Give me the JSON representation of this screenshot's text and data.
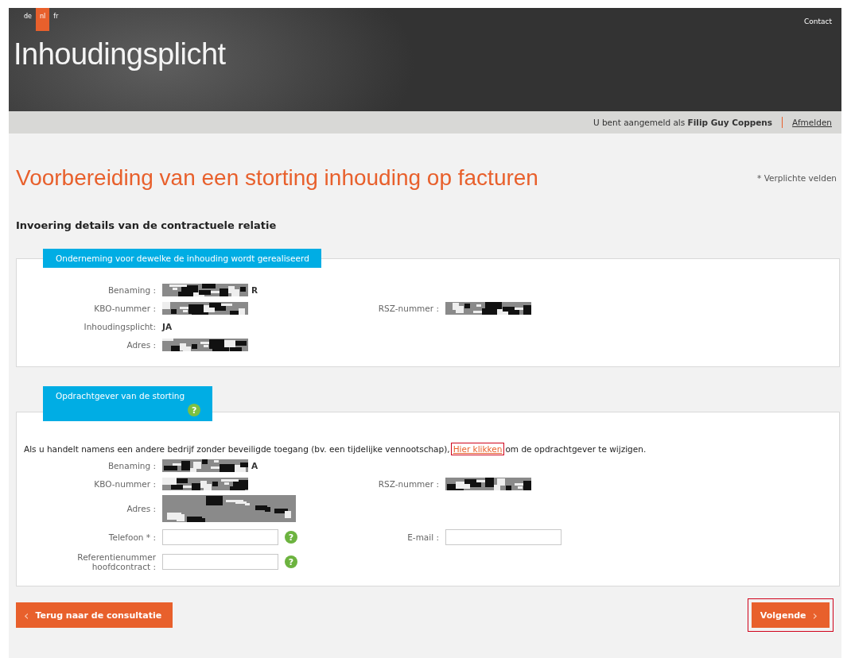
{
  "header": {
    "languages": [
      {
        "label": "de",
        "selected": false
      },
      {
        "label": "nl",
        "selected": true
      },
      {
        "label": "fr",
        "selected": false
      }
    ],
    "contact": "Contact",
    "logo": "Inhoudingsplicht"
  },
  "user_bar": {
    "text": "U bent aangemeld als **Filip Guy Coppens**",
    "logout": "Afmelden"
  },
  "page": {
    "title": "Voorbereiding van een storting inhouding op facturen",
    "required_note": "* Verplichte velden",
    "subtitle": "Invoering details van de contractuele relatie"
  },
  "sections": [
    {
      "title": "Onderneming voor dewelke de inhouding wordt gerealiseerd",
      "rows": [
        {
          "fields": [
            {
              "label": "Benaming :",
              "kind": "redacted",
              "tail": "R"
            }
          ]
        },
        {
          "fields": [
            {
              "label": "KBO-nummer :",
              "kind": "redacted"
            },
            {
              "label": "RSZ-nummer :",
              "kind": "redacted"
            }
          ]
        },
        {
          "fields": [
            {
              "label": "Inhoudingsplicht:",
              "kind": "text",
              "value": "JA"
            }
          ]
        },
        {
          "fields": [
            {
              "label": "Adres :",
              "kind": "redacted"
            }
          ]
        }
      ]
    },
    {
      "title": "Opdrachtgever van de storting",
      "help": "?",
      "intro": "Als u handelt namens een andere bedrijf zonder beveiligde toegang (bv. een tijdelijke vennootschap),",
      "link": {
        "label": "Hier klikken",
        "highlighted": true
      },
      "intro_end": "om de opdrachtgever te wijzigen.",
      "rows": [
        {
          "fields": [
            {
              "label": "Benaming :",
              "kind": "redacted",
              "tail": "A"
            }
          ]
        },
        {
          "fields": [
            {
              "label": "KBO-nummer :",
              "kind": "redacted"
            },
            {
              "label": "RSZ-nummer :",
              "kind": "redacted"
            }
          ]
        },
        {
          "fields": [
            {
              "label": "Adres :",
              "kind": "redacted_tall"
            }
          ]
        },
        {
          "fields": [
            {
              "label": "Telefoon * :",
              "kind": "input",
              "help": "?"
            },
            {
              "label": "E-mail :",
              "kind": "input"
            }
          ]
        },
        {
          "fields": [
            {
              "label": "Referentienummer hoofdcontract :",
              "kind": "input",
              "help": "?"
            }
          ]
        }
      ]
    }
  ],
  "buttons": {
    "back": {
      "label": "Terug naar de consultatie",
      "arrow": "‹"
    },
    "next": {
      "label": "Volgende",
      "arrow": "›",
      "highlighted": true
    }
  }
}
